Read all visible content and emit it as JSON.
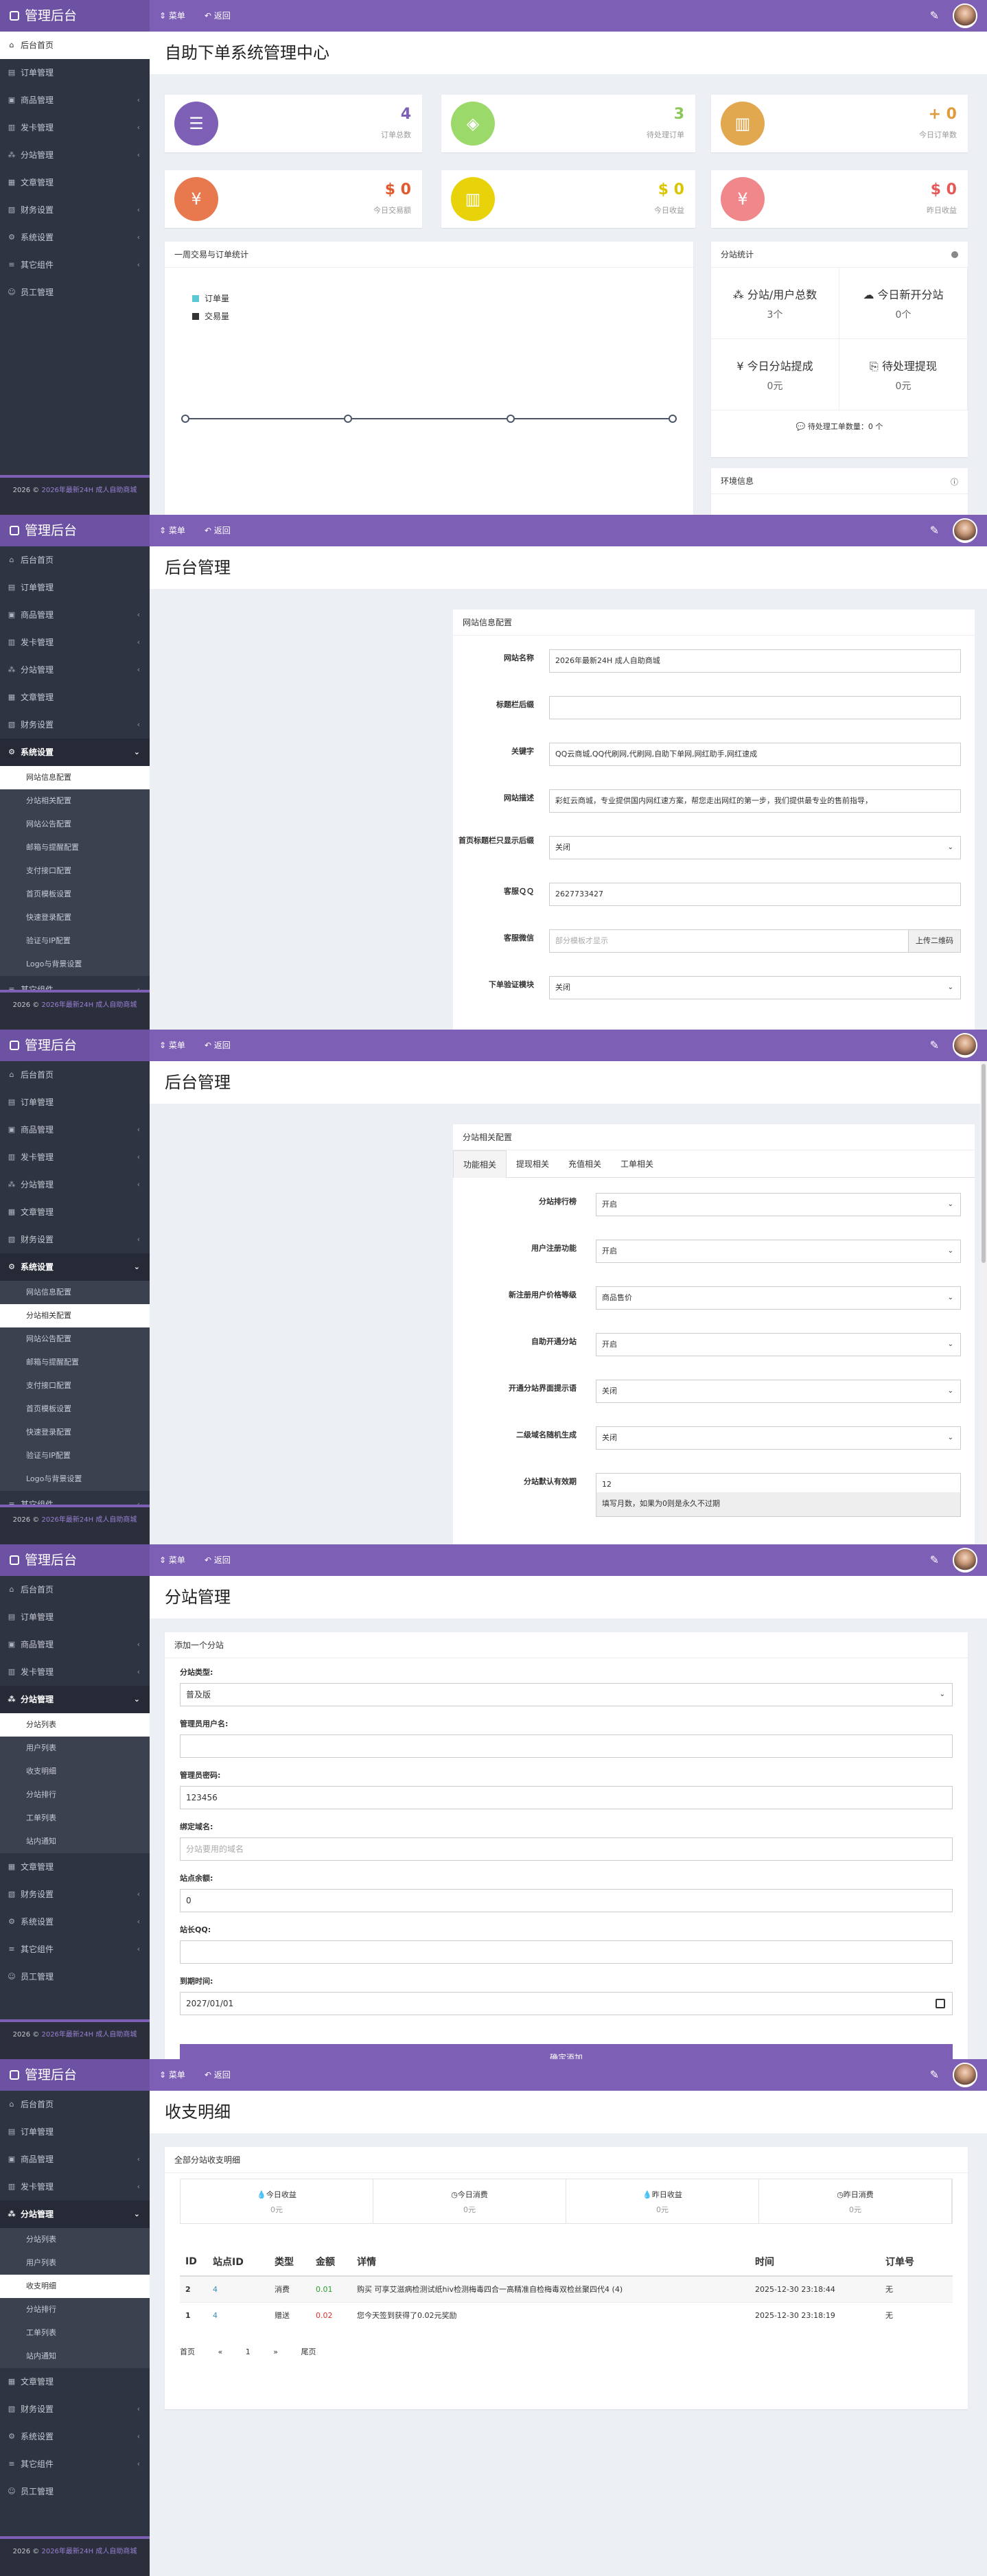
{
  "app": {
    "title": "管理后台",
    "menu": "菜单",
    "back": "返回"
  },
  "nav": [
    "后台首页",
    "订单管理",
    "商品管理",
    "发卡管理",
    "分站管理",
    "文章管理",
    "财务设置",
    "系统设置",
    "其它组件",
    "员工管理"
  ],
  "settings_sub": [
    "网站信息配置",
    "分站相关配置",
    "网站公告配置",
    "邮箱与提醒配置",
    "支付接口配置",
    "首页模板设置",
    "快速登录配置",
    "验证与IP配置",
    "Logo与背景设置"
  ],
  "branch_sub": [
    "分站列表",
    "用户列表",
    "收支明细",
    "分站排行",
    "工单列表",
    "站内通知"
  ],
  "footer": {
    "year": "2026 ©",
    "site": "2026年最新24H 成人自助商城"
  },
  "f1": {
    "title": "自助下单系统管理中心",
    "stats": [
      {
        "value": "4",
        "label": "订单总数",
        "color": "#7e5fb6",
        "text": "#7e5fb6",
        "icon": "list-icon"
      },
      {
        "value": "3",
        "label": "待处理订单",
        "color": "#9bd96b",
        "text": "#8ac85a",
        "icon": "cube-icon"
      },
      {
        "value": "+ 0",
        "label": "今日订单数",
        "color": "#e2a84f",
        "text": "#e09b3d",
        "icon": "briefcase-icon"
      },
      {
        "value": "$ 0",
        "label": "今日交易额",
        "color": "#e8784e",
        "text": "#e05a2e",
        "icon": "yen-icon"
      },
      {
        "value": "$ 0",
        "label": "今日收益",
        "color": "#e8d20a",
        "text": "#d9c600",
        "icon": "briefcase-icon"
      },
      {
        "value": "$ 0",
        "label": "昨日收益",
        "color": "#f0878a",
        "text": "#e45a5a",
        "icon": "yen-icon"
      }
    ],
    "chart_title": "一周交易与订单统计",
    "legend": [
      {
        "name": "订单量",
        "color": "#5bc8d8"
      },
      {
        "name": "交易量",
        "color": "#333333"
      }
    ],
    "branch_title": "分站统计",
    "branch": [
      {
        "label": "分站/用户总数",
        "value": "3个"
      },
      {
        "label": "今日新开分站",
        "value": "0个"
      },
      {
        "label": "今日分站提成",
        "value": "0元"
      },
      {
        "label": "待处理提现",
        "value": "0元"
      }
    ],
    "pending": "待处理工单数量：0 个",
    "env": "环境信息"
  },
  "f2": {
    "title": "后台管理",
    "card": "网站信息配置",
    "rows": [
      {
        "label": "网站名称",
        "value": "2026年最新24H 成人自助商城",
        "ph": false
      },
      {
        "label": "标题栏后缀",
        "value": "",
        "ph": false
      },
      {
        "label": "关键字",
        "value": "QQ云商城,QQ代刷网,代刷网,自助下单网,网红助手,网红速成",
        "ph": false
      },
      {
        "label": "网站描述",
        "value": "彩虹云商城，专业提供国内网红速方案，帮您走出网红的第一步，我们提供最专业的售前指导，",
        "ph": false
      },
      {
        "label": "首页标题栏只显示后缀",
        "value": "关闭",
        "ph": false,
        "select": true
      },
      {
        "label": "客服ＱＱ",
        "value": "2627733427",
        "ph": false
      },
      {
        "label": "客服微信",
        "value": "部分模板才显示",
        "ph": true,
        "button": "上传二维码"
      },
      {
        "label": "下单验证模块",
        "value": "关闭",
        "ph": false,
        "select": true
      }
    ]
  },
  "f3": {
    "title": "后台管理",
    "card": "分站相关配置",
    "tabs": [
      "功能相关",
      "提现相关",
      "充值相关",
      "工单相关"
    ],
    "rows": [
      {
        "label": "分站排行榜",
        "value": "开启"
      },
      {
        "label": "用户注册功能",
        "value": "开启"
      },
      {
        "label": "新注册用户价格等级",
        "value": "商品售价"
      },
      {
        "label": "自助开通分站",
        "value": "开启"
      },
      {
        "label": "开通分站界面提示语",
        "value": "关闭"
      },
      {
        "label": "二级域名随机生成",
        "value": "关闭"
      },
      {
        "label": "分站默认有效期",
        "value": "12"
      }
    ],
    "hint": "填写月数，如果为0则是永久不过期"
  },
  "f4": {
    "title": "分站管理",
    "card": "添加一个分站",
    "fields": [
      {
        "label": "分站类型:",
        "value": "普及版",
        "ph": false,
        "select": true
      },
      {
        "label": "管理员用户名:",
        "value": "",
        "ph": false
      },
      {
        "label": "管理员密码:",
        "value": "123456",
        "ph": false
      },
      {
        "label": "绑定域名:",
        "value": "分站要用的域名",
        "ph": true
      },
      {
        "label": "站点余额:",
        "value": "0",
        "ph": false
      },
      {
        "label": "站长QQ:",
        "value": "",
        "ph": false
      },
      {
        "label": "到期时间:",
        "value": "2027/01/01",
        "ph": false,
        "date": true
      }
    ],
    "submit": "确定添加"
  },
  "f5": {
    "title": "收支明细",
    "card": "全部分站收支明细",
    "summary": [
      {
        "label": "今日收益",
        "value": "0元"
      },
      {
        "label": "今日消费",
        "value": "0元"
      },
      {
        "label": "昨日收益",
        "value": "0元"
      },
      {
        "label": "昨日消费",
        "value": "0元"
      }
    ],
    "columns": [
      "ID",
      "站点ID",
      "类型",
      "金额",
      "详情",
      "时间",
      "订单号"
    ],
    "rows": [
      {
        "id": "2",
        "site": "4",
        "type": "消费",
        "amount": "0.01",
        "color": "#2a9d2a",
        "detail": "购买 可享艾滋病检测试纸hiv检测梅毒四合一高精准自检梅毒双检丝聚四代4 (4)",
        "time": "2025-12-30 23:18:44",
        "order": "无"
      },
      {
        "id": "1",
        "site": "4",
        "type": "赠送",
        "amount": "0.02",
        "color": "#e03030",
        "detail": "您今天签到获得了0.02元奖励",
        "time": "2025-12-30 23:18:19",
        "order": "无"
      }
    ],
    "pager": [
      "首页",
      "«",
      "1",
      "»",
      "尾页"
    ]
  }
}
